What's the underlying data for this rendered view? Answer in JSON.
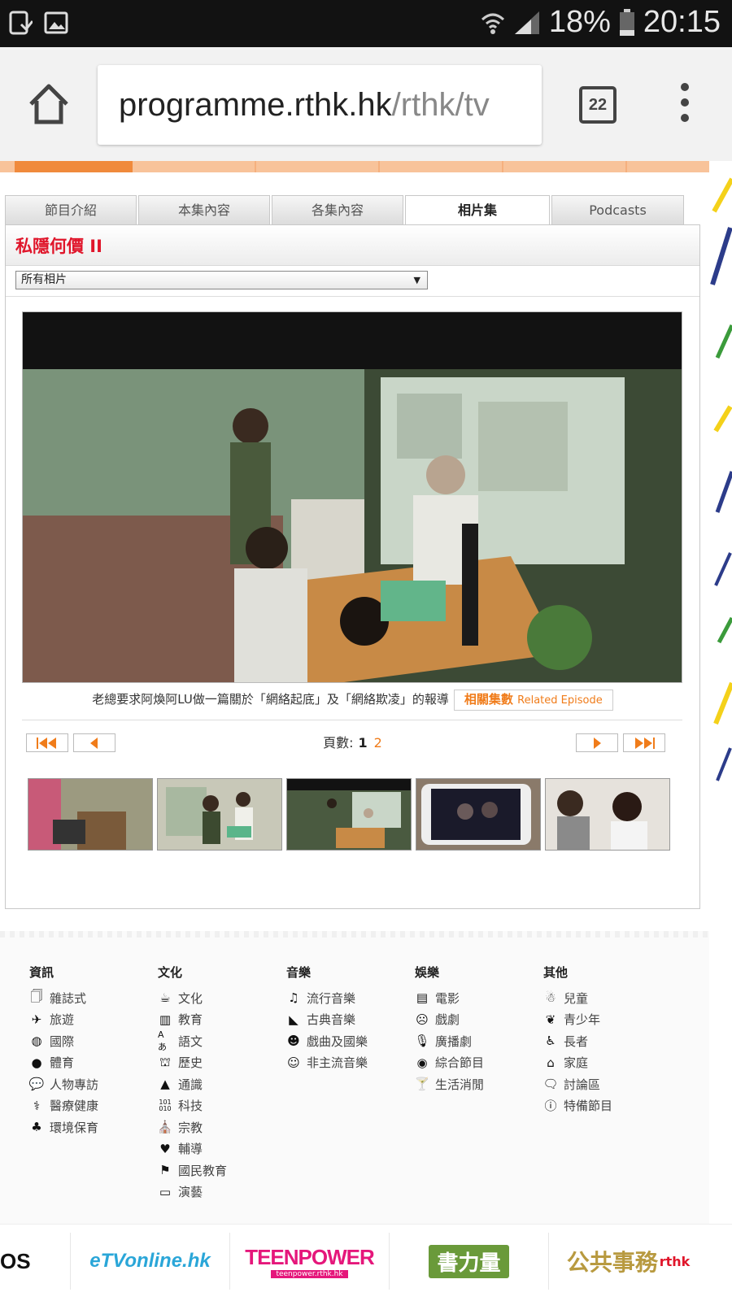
{
  "status_bar": {
    "battery": "18%",
    "time": "20:15"
  },
  "browser": {
    "url_host": "programme.rthk.hk",
    "url_path": "/rthk/tv",
    "tab_count": "22"
  },
  "tabs": [
    {
      "label": "節目介紹",
      "active": false
    },
    {
      "label": "本集內容",
      "active": false
    },
    {
      "label": "各集內容",
      "active": false
    },
    {
      "label": "相片集",
      "active": true
    },
    {
      "label": "Podcasts",
      "active": false
    }
  ],
  "program": {
    "title": "私隱何價 II",
    "filter_selected": "所有相片",
    "caption": "老總要求阿煥阿LU做一篇關於「網絡起底」及「網絡欺凌」的報導",
    "related_label": "相關集數",
    "related_label_en": "Related Episode"
  },
  "pager": {
    "label": "頁數:",
    "current": "1",
    "next": "2"
  },
  "footer": {
    "columns": [
      {
        "heading": "資訊",
        "items": [
          {
            "label": "雜誌式",
            "icon": "magazine-icon"
          },
          {
            "label": "旅遊",
            "icon": "airplane-icon"
          },
          {
            "label": "國際",
            "icon": "globe-icon"
          },
          {
            "label": "體育",
            "icon": "ball-icon"
          },
          {
            "label": "人物專訪",
            "icon": "chat-icon"
          },
          {
            "label": "醫療健康",
            "icon": "stethoscope-icon"
          },
          {
            "label": "環境保育",
            "icon": "tree-icon"
          }
        ]
      },
      {
        "heading": "文化",
        "items": [
          {
            "label": "文化",
            "icon": "teapot-icon"
          },
          {
            "label": "教育",
            "icon": "books-icon"
          },
          {
            "label": "語文",
            "icon": "language-icon"
          },
          {
            "label": "歷史",
            "icon": "museum-icon"
          },
          {
            "label": "通識",
            "icon": "graduation-cap-icon"
          },
          {
            "label": "科技",
            "icon": "binary-icon"
          },
          {
            "label": "宗教",
            "icon": "church-icon"
          },
          {
            "label": "輔導",
            "icon": "heart-icon"
          },
          {
            "label": "國民教育",
            "icon": "flag-icon"
          },
          {
            "label": "演藝",
            "icon": "tv-icon"
          }
        ]
      },
      {
        "heading": "音樂",
        "items": [
          {
            "label": "流行音樂",
            "icon": "music-note-icon"
          },
          {
            "label": "古典音樂",
            "icon": "piano-icon"
          },
          {
            "label": "戲曲及國樂",
            "icon": "opera-mask-icon"
          },
          {
            "label": "非主流音樂",
            "icon": "theatre-masks-icon"
          }
        ]
      },
      {
        "heading": "娛樂",
        "items": [
          {
            "label": "電影",
            "icon": "film-icon"
          },
          {
            "label": "戲劇",
            "icon": "drama-mask-icon"
          },
          {
            "label": "廣播劇",
            "icon": "microphone-icon"
          },
          {
            "label": "綜合節目",
            "icon": "record-icon"
          },
          {
            "label": "生活消閒",
            "icon": "cocktail-icon"
          }
        ]
      },
      {
        "heading": "其他",
        "items": [
          {
            "label": "兒童",
            "icon": "child-icon"
          },
          {
            "label": "青少年",
            "icon": "leaf-icon"
          },
          {
            "label": "長者",
            "icon": "elderly-icon"
          },
          {
            "label": "家庭",
            "icon": "house-icon"
          },
          {
            "label": "討論區",
            "icon": "speech-bubble-icon"
          },
          {
            "label": "特備節目",
            "icon": "exclamation-icon"
          }
        ]
      }
    ]
  },
  "logos": {
    "partial": "OS",
    "etv": "eTVonline.hk",
    "teenpower": "TEENPOWER",
    "teenpower_sub": "teenpower.rthk.hk",
    "book": "書力量",
    "public_affairs": "公共事務",
    "rthk": "rthk"
  },
  "colors": {
    "accent": "#f07c1a",
    "title_red": "#e0162b",
    "status_bg": "#121212"
  }
}
